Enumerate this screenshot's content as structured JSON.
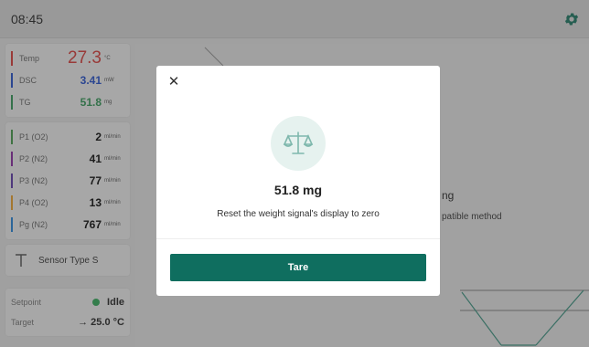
{
  "header": {
    "time": "08:45",
    "settings_icon": "gear-icon"
  },
  "sidebar": {
    "measurements": [
      {
        "label": "Temp",
        "value": "27.3",
        "unit": "°C",
        "color": "#e53935"
      },
      {
        "label": "DSC",
        "value": "3.41",
        "unit": "mW",
        "color": "#1e4fd8"
      },
      {
        "label": "TG",
        "value": "51.8",
        "unit": "mg",
        "color": "#2e9d57"
      }
    ],
    "gases": [
      {
        "label": "P1 (O2)",
        "value": "2",
        "unit": "ml/min",
        "color": "#43a047"
      },
      {
        "label": "P2 (N2)",
        "value": "41",
        "unit": "ml/min",
        "color": "#8e24aa"
      },
      {
        "label": "P3 (N2)",
        "value": "77",
        "unit": "ml/min",
        "color": "#5e35b1"
      },
      {
        "label": "P4 (O2)",
        "value": "13",
        "unit": "ml/min",
        "color": "#f9a825"
      },
      {
        "label": "Pg (N2)",
        "value": "767",
        "unit": "ml/min",
        "color": "#1e88e5"
      }
    ],
    "sensor": "Sensor Type S",
    "setpoint_label": "Setpoint",
    "setpoint_value": "Idle",
    "target_label": "Target",
    "target_value": "→ 25.0 °C"
  },
  "background": {
    "title_fragment": "ng",
    "subtitle_fragment": "patible method"
  },
  "modal": {
    "icon": "scale-icon",
    "weight": "51.8 mg",
    "description": "Reset the weight signal's display to zero",
    "button_label": "Tare",
    "accent": "#0f6e5f"
  }
}
